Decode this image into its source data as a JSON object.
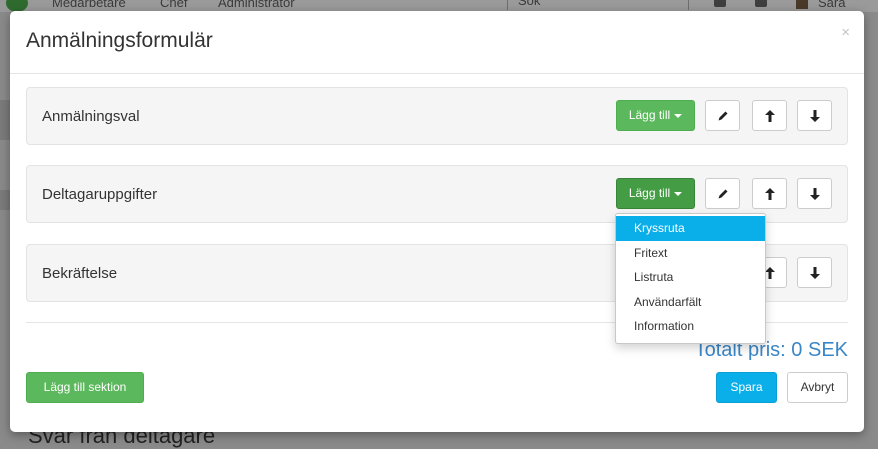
{
  "background": {
    "nav": [
      "Medarbetare",
      "Chef",
      "Administratör"
    ],
    "search_placeholder": "Sök",
    "user_name": "Sara",
    "bottom_text": "Svar från deltagare"
  },
  "modal": {
    "title": "Anmälningsformulär",
    "close_glyph": "×",
    "sections": [
      {
        "title": "Anmälningsval",
        "add_label": "Lägg till"
      },
      {
        "title": "Deltagaruppgifter",
        "add_label": "Lägg till"
      },
      {
        "title": "Bekräftelse"
      }
    ],
    "dropdown": {
      "items": [
        "Kryssruta",
        "Fritext",
        "Listruta",
        "Användarfält",
        "Information"
      ],
      "active_index": 0
    },
    "total": "Totalt pris: 0 SEK",
    "add_section_label": "Lägg till sektion",
    "save_label": "Spara",
    "cancel_label": "Avbryt"
  },
  "colors": {
    "green": "#5cb85c",
    "blue": "#0aaee8",
    "total_text": "#3a87c8"
  },
  "icons": {
    "edit": "pencil-icon",
    "up": "arrow-up-icon",
    "down": "arrow-down-icon"
  }
}
